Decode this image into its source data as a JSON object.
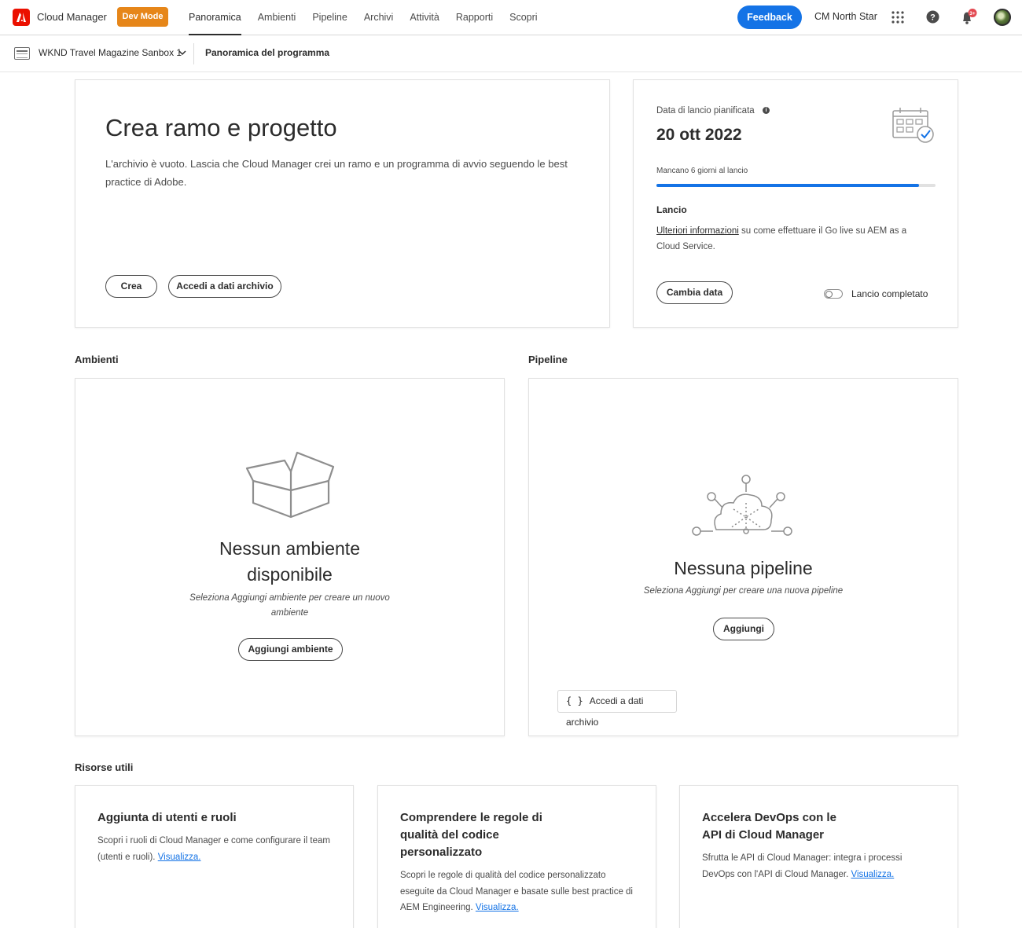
{
  "topbar": {
    "app_name": "Cloud Manager",
    "dev_mode": "Dev Mode",
    "nav": [
      "Panoramica",
      "Ambienti",
      "Pipeline",
      "Archivi",
      "Attività",
      "Rapporti",
      "Scopri"
    ],
    "active_nav": "Panoramica",
    "feedback": "Feedback",
    "org": "CM North Star",
    "notification_count": "3+",
    "colors": {
      "brand": "#eb1000",
      "dev_mode": "#e68619",
      "accent": "#1473e6"
    }
  },
  "subbar": {
    "program": "WKND Travel Magazine Sanbox 1",
    "title": "Panoramica del programma"
  },
  "hero": {
    "title": "Crea ramo e progetto",
    "text": "L'archivio è vuoto. Lascia che Cloud Manager crei un ramo e un programma di avvio seguendo le best practice di Adobe.",
    "create_btn": "Crea",
    "repo_btn": "Accedi a dati archivio"
  },
  "launch": {
    "label": "Data di lancio pianificata",
    "date": "20 ott 2022",
    "remaining": "Mancano 6 giorni al lancio",
    "progress": 0.94,
    "title": "Lancio",
    "link": "Ulteriori informazioni",
    "text": " su come effettuare il Go live su AEM as a Cloud Service.",
    "change_btn": "Cambia data",
    "toggle_label": "Lancio completato",
    "toggle_on": false
  },
  "environments": {
    "section": "Ambienti",
    "title_line1": "Nessun ambiente",
    "title_line2": "disponibile",
    "subtitle_line1": "Seleziona Aggiungi ambiente per creare un nuovo",
    "subtitle_line2": "ambiente",
    "add_btn": "Aggiungi ambiente"
  },
  "pipelines": {
    "section": "Pipeline",
    "title": "Nessuna pipeline",
    "subtitle": "Seleziona Aggiungi per creare una nuova pipeline",
    "add_btn": "Aggiungi",
    "repo_btn": "Accedi a dati archivio",
    "repo_icon": "{ }"
  },
  "resources": {
    "section": "Risorse utili",
    "cards": [
      {
        "title": "Aggiunta di utenti e ruoli",
        "text": "Scopri i ruoli di Cloud Manager e come configurare il team (utenti e ruoli). ",
        "link": "Visualizza."
      },
      {
        "title": "Comprendere le regole di qualità del codice personalizzato",
        "text": "Scopri le regole di qualità del codice personalizzato eseguite da Cloud Manager e basate sulle best practice di AEM Engineering. ",
        "link": "Visualizza."
      },
      {
        "title": "Accelera DevOps con le API di Cloud Manager",
        "text": "Sfrutta le API di Cloud Manager: integra i processi DevOps con l'API di Cloud Manager. ",
        "link": "Visualizza."
      }
    ]
  }
}
